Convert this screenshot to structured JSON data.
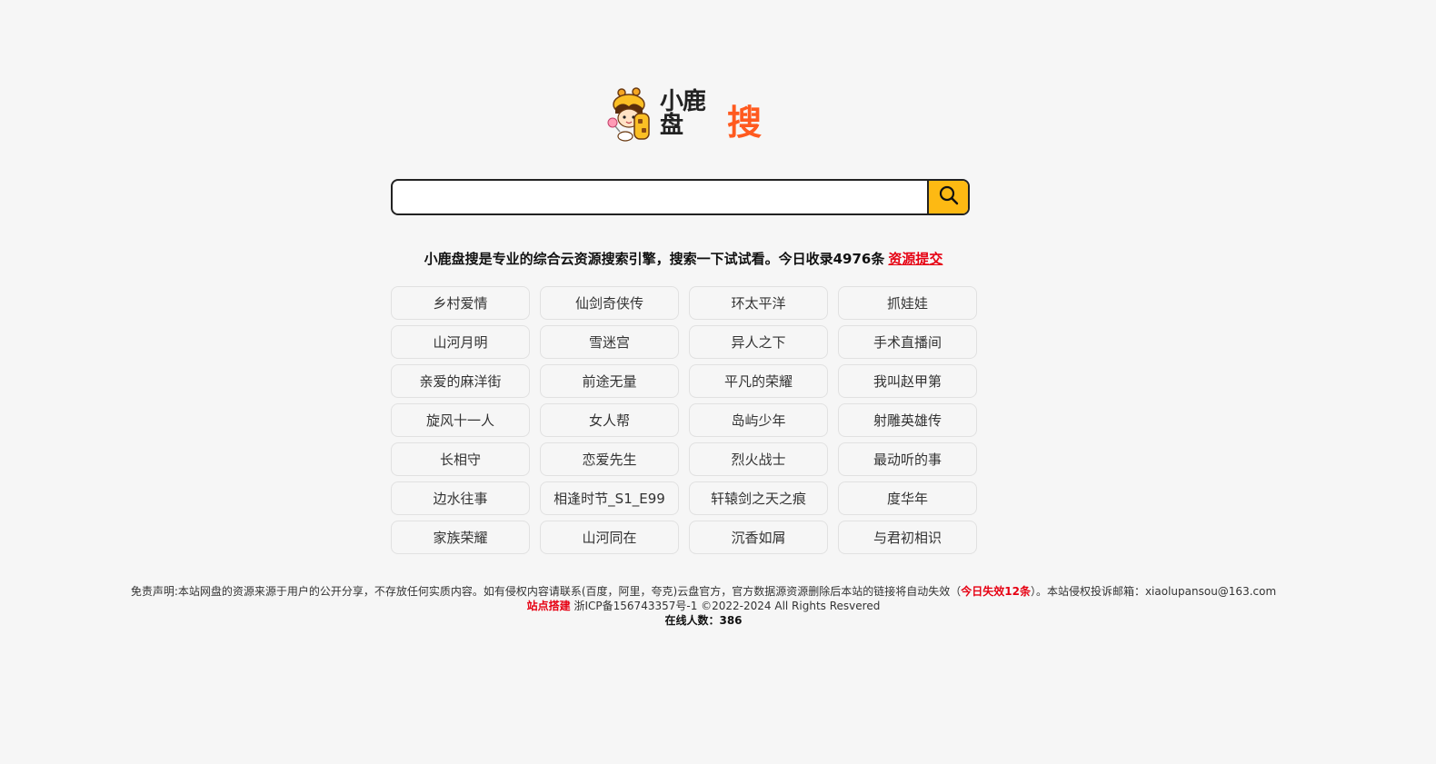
{
  "logo": {
    "text_small": "小鹿盘",
    "text_big": "搜",
    "mascot_icon": "giraffe-mascot-icon",
    "accent_color": "#ff5a1f"
  },
  "search": {
    "value": "",
    "placeholder": "",
    "button_icon": "search-icon",
    "button_color": "#fdb913"
  },
  "tagline": {
    "text": "小鹿盘搜是专业的综合云资源搜索引擎，搜索一下试试看。今日收录4976条",
    "submit_link": "资源提交"
  },
  "hot_keywords": [
    "乡村爱情",
    "仙剑奇侠传",
    "环太平洋",
    "抓娃娃",
    "山河月明",
    "雪迷宫",
    "异人之下",
    "手术直播间",
    "亲爱的麻洋街",
    "前途无量",
    "平凡的荣耀",
    "我叫赵甲第",
    "旋风十一人",
    "女人帮",
    "岛屿少年",
    "射雕英雄传",
    "长相守",
    "恋爱先生",
    "烈火战士",
    "最动听的事",
    "边水往事",
    "相逢时节_S1_E99",
    "轩辕剑之天之痕",
    "度华年",
    "家族荣耀",
    "山河同在",
    "沉香如屑",
    "与君初相识"
  ],
  "footer": {
    "disclaimer_prefix": "免责声明:本站网盘的资源来源于用户的公开分享，不存放任何实质内容。如有侵权内容请联系(百度，阿里，夸克)云盘官方，官方数据源资源删除后本站的链接将自动失效（",
    "expired_today": "今日失效12条",
    "disclaimer_suffix": "）。本站侵权投诉邮箱：xiaolupansou@163.com",
    "site_build_link": "站点搭建",
    "icp_copyright": "浙ICP备156743357号-1 ©2022-2024 All Rights Resvered",
    "online_count": "在线人数：386",
    "highlight_color": "#e60012"
  }
}
